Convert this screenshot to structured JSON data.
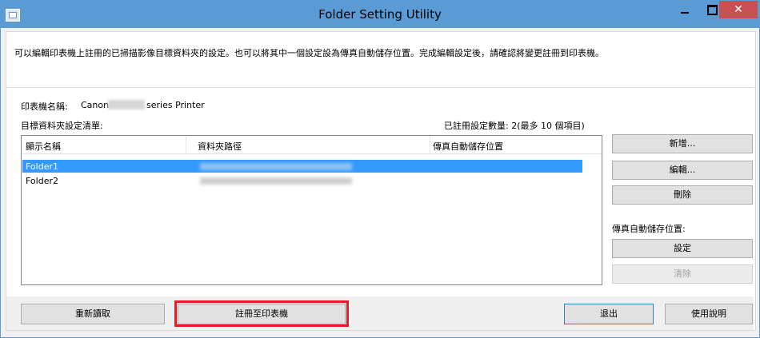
{
  "window": {
    "title": "Folder Setting Utility",
    "close_glyph": "✕"
  },
  "description": "可以編輯印表機上註冊的已掃描影像目標資料夾的設定。也可以將其中一個設定設為傳真自動儲存位置。完成編輯設定後，請確認將變更註冊到印表機。",
  "printer": {
    "label": "印表機名稱:",
    "model_prefix": "Canon",
    "model_suffix": "series Printer"
  },
  "folder_list": {
    "title": "目標資料夾設定清單:",
    "registered_count": "已註冊設定數量: 2(最多 10 個項目)",
    "columns": [
      "顯示名稱",
      "資料夾路徑",
      "傳真自動儲存位置"
    ],
    "rows": [
      {
        "name": "Folder1",
        "selected": true
      },
      {
        "name": "Folder2",
        "selected": false
      }
    ]
  },
  "side_buttons": {
    "add": "新增...",
    "edit": "編輯...",
    "delete": "刪除",
    "fax_label": "傳真自動儲存位置:",
    "set": "設定",
    "clear": "清除"
  },
  "bottom_buttons": {
    "reload": "重新讀取",
    "register": "註冊至印表機",
    "exit": "退出",
    "help": "使用說明"
  },
  "colors": {
    "titlebar": "#5b9bd5",
    "selection": "#3399ff",
    "close": "#c75050",
    "highlight": "#e21f26"
  }
}
